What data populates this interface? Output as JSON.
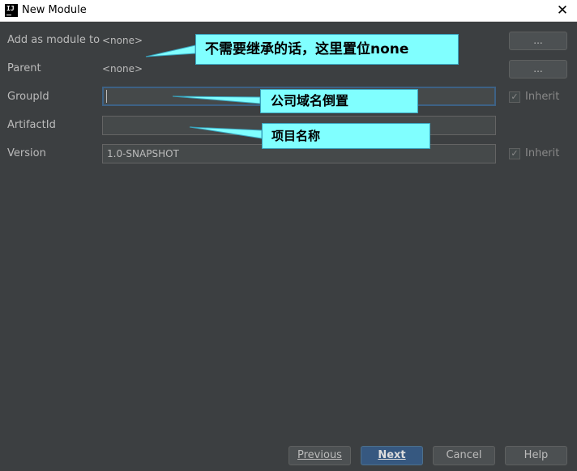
{
  "window": {
    "title": "New Module",
    "app_icon_text": "IJ"
  },
  "form": {
    "add_as_module_label": "Add as module to",
    "add_as_module_value": "<none>",
    "parent_label": "Parent",
    "parent_value": "<none>",
    "groupid_label": "GroupId",
    "groupid_value": "",
    "artifactid_label": "ArtifactId",
    "artifactid_value": "",
    "version_label": "Version",
    "version_value": "1.0-SNAPSHOT",
    "browse_label": "...",
    "inherit_label": "Inherit"
  },
  "annotations": {
    "module_note": "不需要继承的话，这里置位none",
    "groupid_note": "公司域名倒置",
    "artifactid_note": "项目名称"
  },
  "buttons": {
    "previous": "Previous",
    "next": "Next",
    "cancel": "Cancel",
    "help": "Help"
  },
  "colors": {
    "background": "#3c3f41",
    "callout": "#80ffff",
    "primary_button": "#365880",
    "focus_border": "#3d6185"
  }
}
